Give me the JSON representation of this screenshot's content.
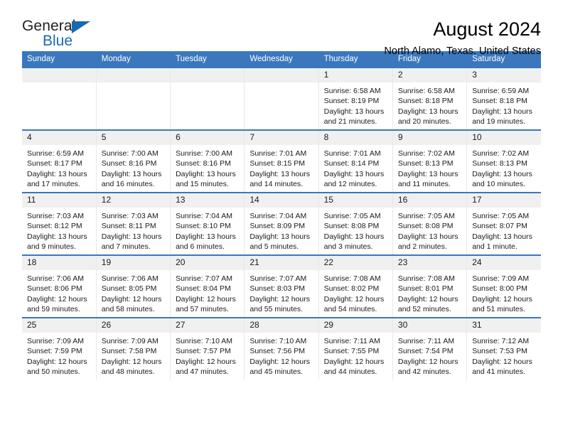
{
  "brand": {
    "name_top": "General",
    "name_bottom": "Blue",
    "accent_color": "#1769b4"
  },
  "header": {
    "title": "August 2024",
    "subtitle": "North Alamo, Texas, United States"
  },
  "theme": {
    "header_blue": "#3b77bd",
    "daynum_bg": "#f0f0f0"
  },
  "weekdays": [
    "Sunday",
    "Monday",
    "Tuesday",
    "Wednesday",
    "Thursday",
    "Friday",
    "Saturday"
  ],
  "weeks": [
    [
      {
        "day": "",
        "empty": true
      },
      {
        "day": "",
        "empty": true
      },
      {
        "day": "",
        "empty": true
      },
      {
        "day": "",
        "empty": true
      },
      {
        "day": "1",
        "sunrise": "Sunrise: 6:58 AM",
        "sunset": "Sunset: 8:19 PM",
        "daylight": "Daylight: 13 hours and 21 minutes."
      },
      {
        "day": "2",
        "sunrise": "Sunrise: 6:58 AM",
        "sunset": "Sunset: 8:18 PM",
        "daylight": "Daylight: 13 hours and 20 minutes."
      },
      {
        "day": "3",
        "sunrise": "Sunrise: 6:59 AM",
        "sunset": "Sunset: 8:18 PM",
        "daylight": "Daylight: 13 hours and 19 minutes."
      }
    ],
    [
      {
        "day": "4",
        "sunrise": "Sunrise: 6:59 AM",
        "sunset": "Sunset: 8:17 PM",
        "daylight": "Daylight: 13 hours and 17 minutes."
      },
      {
        "day": "5",
        "sunrise": "Sunrise: 7:00 AM",
        "sunset": "Sunset: 8:16 PM",
        "daylight": "Daylight: 13 hours and 16 minutes."
      },
      {
        "day": "6",
        "sunrise": "Sunrise: 7:00 AM",
        "sunset": "Sunset: 8:16 PM",
        "daylight": "Daylight: 13 hours and 15 minutes."
      },
      {
        "day": "7",
        "sunrise": "Sunrise: 7:01 AM",
        "sunset": "Sunset: 8:15 PM",
        "daylight": "Daylight: 13 hours and 14 minutes."
      },
      {
        "day": "8",
        "sunrise": "Sunrise: 7:01 AM",
        "sunset": "Sunset: 8:14 PM",
        "daylight": "Daylight: 13 hours and 12 minutes."
      },
      {
        "day": "9",
        "sunrise": "Sunrise: 7:02 AM",
        "sunset": "Sunset: 8:13 PM",
        "daylight": "Daylight: 13 hours and 11 minutes."
      },
      {
        "day": "10",
        "sunrise": "Sunrise: 7:02 AM",
        "sunset": "Sunset: 8:13 PM",
        "daylight": "Daylight: 13 hours and 10 minutes."
      }
    ],
    [
      {
        "day": "11",
        "sunrise": "Sunrise: 7:03 AM",
        "sunset": "Sunset: 8:12 PM",
        "daylight": "Daylight: 13 hours and 9 minutes."
      },
      {
        "day": "12",
        "sunrise": "Sunrise: 7:03 AM",
        "sunset": "Sunset: 8:11 PM",
        "daylight": "Daylight: 13 hours and 7 minutes."
      },
      {
        "day": "13",
        "sunrise": "Sunrise: 7:04 AM",
        "sunset": "Sunset: 8:10 PM",
        "daylight": "Daylight: 13 hours and 6 minutes."
      },
      {
        "day": "14",
        "sunrise": "Sunrise: 7:04 AM",
        "sunset": "Sunset: 8:09 PM",
        "daylight": "Daylight: 13 hours and 5 minutes."
      },
      {
        "day": "15",
        "sunrise": "Sunrise: 7:05 AM",
        "sunset": "Sunset: 8:08 PM",
        "daylight": "Daylight: 13 hours and 3 minutes."
      },
      {
        "day": "16",
        "sunrise": "Sunrise: 7:05 AM",
        "sunset": "Sunset: 8:08 PM",
        "daylight": "Daylight: 13 hours and 2 minutes."
      },
      {
        "day": "17",
        "sunrise": "Sunrise: 7:05 AM",
        "sunset": "Sunset: 8:07 PM",
        "daylight": "Daylight: 13 hours and 1 minute."
      }
    ],
    [
      {
        "day": "18",
        "sunrise": "Sunrise: 7:06 AM",
        "sunset": "Sunset: 8:06 PM",
        "daylight": "Daylight: 12 hours and 59 minutes."
      },
      {
        "day": "19",
        "sunrise": "Sunrise: 7:06 AM",
        "sunset": "Sunset: 8:05 PM",
        "daylight": "Daylight: 12 hours and 58 minutes."
      },
      {
        "day": "20",
        "sunrise": "Sunrise: 7:07 AM",
        "sunset": "Sunset: 8:04 PM",
        "daylight": "Daylight: 12 hours and 57 minutes."
      },
      {
        "day": "21",
        "sunrise": "Sunrise: 7:07 AM",
        "sunset": "Sunset: 8:03 PM",
        "daylight": "Daylight: 12 hours and 55 minutes."
      },
      {
        "day": "22",
        "sunrise": "Sunrise: 7:08 AM",
        "sunset": "Sunset: 8:02 PM",
        "daylight": "Daylight: 12 hours and 54 minutes."
      },
      {
        "day": "23",
        "sunrise": "Sunrise: 7:08 AM",
        "sunset": "Sunset: 8:01 PM",
        "daylight": "Daylight: 12 hours and 52 minutes."
      },
      {
        "day": "24",
        "sunrise": "Sunrise: 7:09 AM",
        "sunset": "Sunset: 8:00 PM",
        "daylight": "Daylight: 12 hours and 51 minutes."
      }
    ],
    [
      {
        "day": "25",
        "sunrise": "Sunrise: 7:09 AM",
        "sunset": "Sunset: 7:59 PM",
        "daylight": "Daylight: 12 hours and 50 minutes."
      },
      {
        "day": "26",
        "sunrise": "Sunrise: 7:09 AM",
        "sunset": "Sunset: 7:58 PM",
        "daylight": "Daylight: 12 hours and 48 minutes."
      },
      {
        "day": "27",
        "sunrise": "Sunrise: 7:10 AM",
        "sunset": "Sunset: 7:57 PM",
        "daylight": "Daylight: 12 hours and 47 minutes."
      },
      {
        "day": "28",
        "sunrise": "Sunrise: 7:10 AM",
        "sunset": "Sunset: 7:56 PM",
        "daylight": "Daylight: 12 hours and 45 minutes."
      },
      {
        "day": "29",
        "sunrise": "Sunrise: 7:11 AM",
        "sunset": "Sunset: 7:55 PM",
        "daylight": "Daylight: 12 hours and 44 minutes."
      },
      {
        "day": "30",
        "sunrise": "Sunrise: 7:11 AM",
        "sunset": "Sunset: 7:54 PM",
        "daylight": "Daylight: 12 hours and 42 minutes."
      },
      {
        "day": "31",
        "sunrise": "Sunrise: 7:12 AM",
        "sunset": "Sunset: 7:53 PM",
        "daylight": "Daylight: 12 hours and 41 minutes."
      }
    ]
  ]
}
